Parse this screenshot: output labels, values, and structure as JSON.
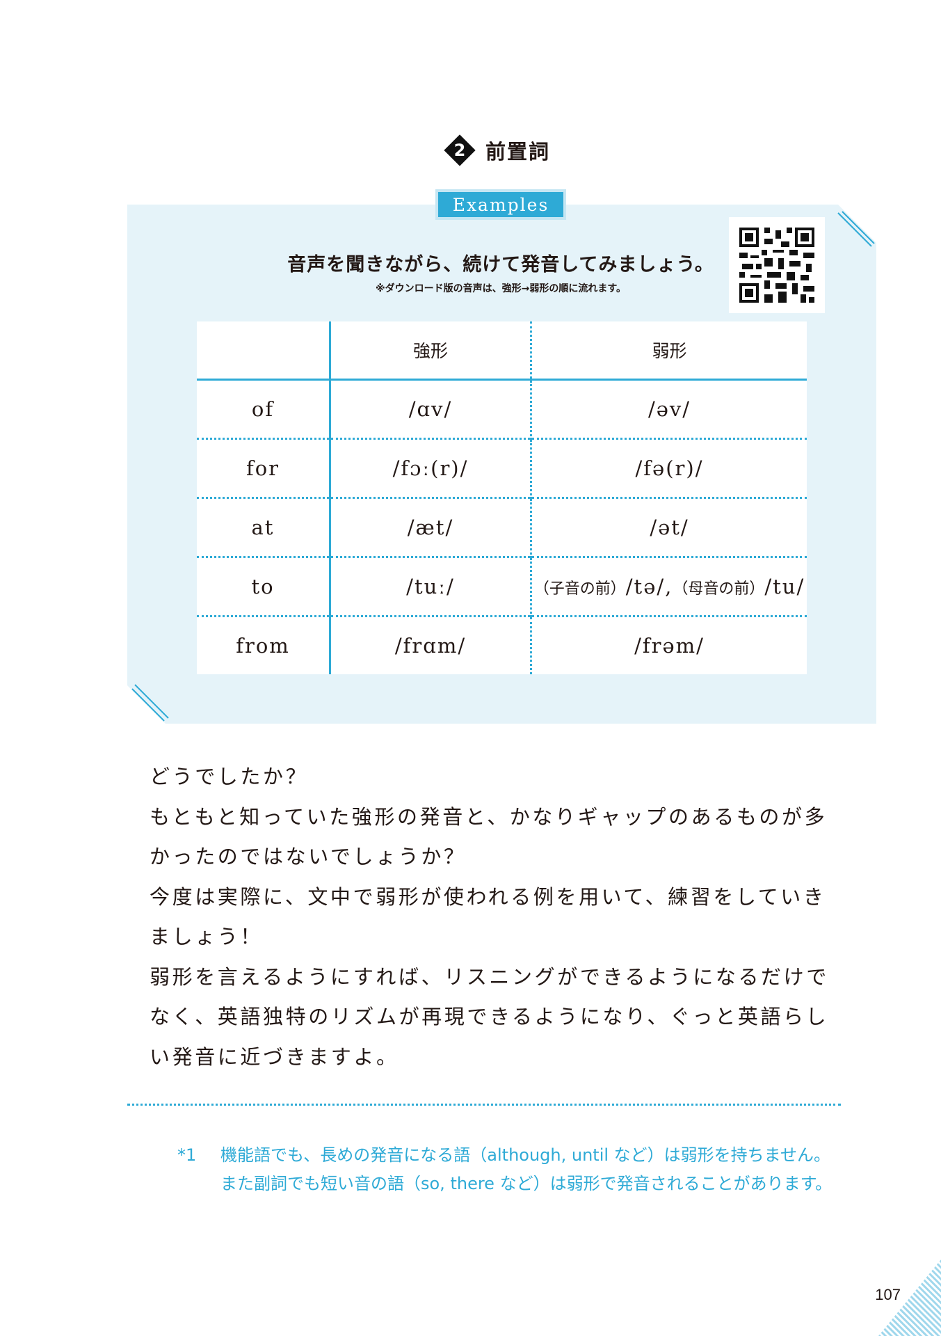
{
  "heading": {
    "number": "2",
    "title": "前置詞"
  },
  "examples_tab": "Examples",
  "instruction": "音声を聞きながら、続けて発音してみましょう。",
  "note": "※ダウンロード版の音声は、強形→弱形の順に流れます。",
  "table": {
    "headers": [
      "",
      "強形",
      "弱形"
    ],
    "rows": [
      {
        "word": "of",
        "strong": "/ɑv/",
        "weak": "/əv/"
      },
      {
        "word": "for",
        "strong": "/fɔː(r)/",
        "weak": "/fə(r)/"
      },
      {
        "word": "at",
        "strong": "/æt/",
        "weak": "/ət/"
      },
      {
        "word": "to",
        "strong": "/tuː/",
        "weak_note1": "（子音の前）",
        "weak_value1": "/tə/,",
        "weak_note2": "（母音の前）",
        "weak_value2": "/tu/"
      },
      {
        "word": "from",
        "strong": "/frɑm/",
        "weak": "/frəm/"
      }
    ]
  },
  "body": {
    "paragraphs": [
      "どうでしたか？",
      "もともと知っていた強形の発音と、かなりギャップのあるものが多かったのではないでしょうか？",
      "今度は実際に、文中で弱形が使われる例を用いて、練習をしていきましょう！",
      "弱形を言えるようにすれば、リスニングができるようになるだけでなく、英語独特のリズムが再現できるようになり、ぐっと英語らしい発音に近づきますよ。"
    ]
  },
  "footnote": {
    "mark": "*1",
    "text": "機能語でも、長めの発音になる語（although, until など）は弱形を持ちません。また副詞でも短い音の語（so, there など）は弱形で発音されることがあります。"
  },
  "page_number": "107",
  "colors": {
    "accent": "#2eaad6",
    "panel": "#e5f3f9",
    "text": "#231815"
  }
}
